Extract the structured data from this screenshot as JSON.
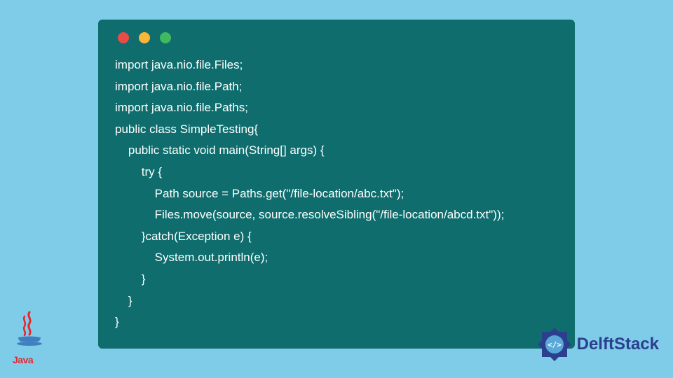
{
  "code": {
    "lines": [
      "import java.nio.file.Files;",
      "import java.nio.file.Path;",
      "import java.nio.file.Paths;",
      "public class SimpleTesting{",
      "    public static void main(String[] args) {",
      "        try {",
      "            Path source = Paths.get(\"/file-location/abc.txt\");",
      "            Files.move(source, source.resolveSibling(\"/file-location/abcd.txt\"));",
      "        }catch(Exception e) {",
      "            System.out.println(e);",
      "        }",
      "    }",
      "}"
    ]
  },
  "branding": {
    "java_label": "Java",
    "delft_label": "DelftStack"
  },
  "colors": {
    "page_bg": "#7fcce9",
    "window_bg": "#0f6d6d",
    "traffic_red": "#e94b47",
    "traffic_yellow": "#fbb537",
    "traffic_green": "#3fba61",
    "java_red": "#e8252b",
    "delft_blue": "#2b3f8e"
  }
}
